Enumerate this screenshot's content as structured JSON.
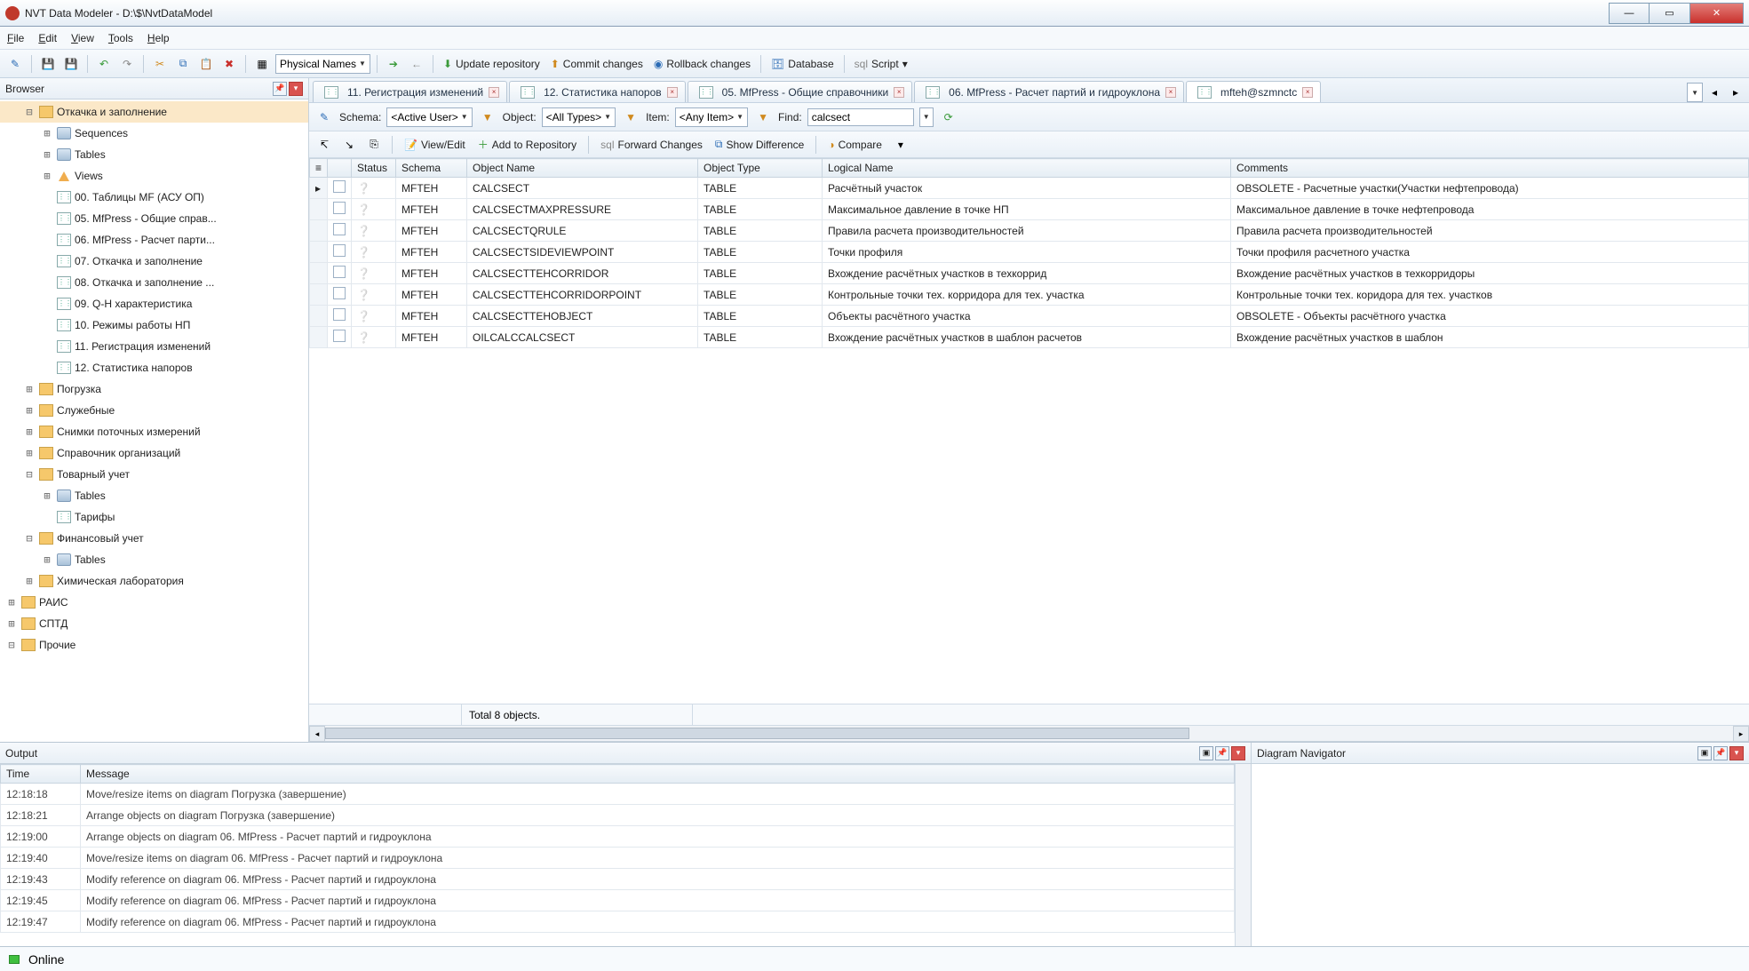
{
  "window": {
    "title": "NVT Data Modeler - D:\\$\\NvtDataModel"
  },
  "menu": {
    "file": "File",
    "edit": "Edit",
    "view": "View",
    "tools": "Tools",
    "help": "Help"
  },
  "toolbar": {
    "combo_mode": "Physical Names",
    "update": "Update repository",
    "commit": "Commit changes",
    "rollback": "Rollback changes",
    "database": "Database",
    "script": "Script"
  },
  "browser": {
    "title": "Browser",
    "nodes": [
      {
        "ind": 1,
        "exp": "⊟",
        "icon": "folder-open",
        "label": "Откачка и заполнение",
        "sel": true
      },
      {
        "ind": 2,
        "exp": "⊞",
        "icon": "cyl",
        "label": "Sequences"
      },
      {
        "ind": 2,
        "exp": "⊞",
        "icon": "cyl",
        "label": "Tables"
      },
      {
        "ind": 2,
        "exp": "⊞",
        "icon": "warn",
        "label": "Views"
      },
      {
        "ind": 2,
        "exp": "",
        "icon": "diag",
        "label": "00. Таблицы MF (АСУ ОП)"
      },
      {
        "ind": 2,
        "exp": "",
        "icon": "diag",
        "label": "05. MfPress - Общие справ..."
      },
      {
        "ind": 2,
        "exp": "",
        "icon": "diag",
        "label": "06. MfPress - Расчет парти..."
      },
      {
        "ind": 2,
        "exp": "",
        "icon": "diag",
        "label": "07. Откачка и заполнение"
      },
      {
        "ind": 2,
        "exp": "",
        "icon": "diag",
        "label": "08. Откачка и заполнение ..."
      },
      {
        "ind": 2,
        "exp": "",
        "icon": "diag",
        "label": "09. Q-H характеристика"
      },
      {
        "ind": 2,
        "exp": "",
        "icon": "diag",
        "label": "10. Режимы работы НП"
      },
      {
        "ind": 2,
        "exp": "",
        "icon": "diag",
        "label": "11. Регистрация изменений"
      },
      {
        "ind": 2,
        "exp": "",
        "icon": "diag",
        "label": "12. Статистика напоров"
      },
      {
        "ind": 1,
        "exp": "⊞",
        "icon": "folder",
        "label": "Погрузка"
      },
      {
        "ind": 1,
        "exp": "⊞",
        "icon": "folder",
        "label": "Служебные"
      },
      {
        "ind": 1,
        "exp": "⊞",
        "icon": "folder",
        "label": "Снимки поточных измерений"
      },
      {
        "ind": 1,
        "exp": "⊞",
        "icon": "folder",
        "label": "Справочник организаций"
      },
      {
        "ind": 1,
        "exp": "⊟",
        "icon": "folder-open",
        "label": "Товарный учет"
      },
      {
        "ind": 2,
        "exp": "⊞",
        "icon": "cyl",
        "label": "Tables"
      },
      {
        "ind": 2,
        "exp": "",
        "icon": "diag",
        "label": "Тарифы"
      },
      {
        "ind": 1,
        "exp": "⊟",
        "icon": "folder-open",
        "label": "Финансовый учет"
      },
      {
        "ind": 2,
        "exp": "⊞",
        "icon": "cyl",
        "label": "Tables"
      },
      {
        "ind": 1,
        "exp": "⊞",
        "icon": "folder",
        "label": "Химическая лаборатория"
      },
      {
        "ind": 0,
        "exp": "⊞",
        "icon": "folder",
        "label": "РАИС"
      },
      {
        "ind": 0,
        "exp": "⊞",
        "icon": "folder",
        "label": "СПТД"
      },
      {
        "ind": 0,
        "exp": "⊟",
        "icon": "folder",
        "label": "Прочие"
      }
    ]
  },
  "tabs": [
    {
      "label": "11. Регистрация изменений"
    },
    {
      "label": "12. Статистика напоров"
    },
    {
      "label": "05. MfPress - Общие справочники"
    },
    {
      "label": "06. MfPress - Расчет партий и гидроуклона"
    },
    {
      "label": "mfteh@szmnctc",
      "active": true
    }
  ],
  "filter": {
    "schema_lbl": "Schema:",
    "schema_val": "<Active User>",
    "object_lbl": "Object:",
    "object_val": "<All Types>",
    "item_lbl": "Item:",
    "item_val": "<Any Item>",
    "find_lbl": "Find:",
    "find_val": "calcsect"
  },
  "actions": {
    "viewedit": "View/Edit",
    "addrepo": "Add to Repository",
    "forward": "Forward Changes",
    "diff": "Show Difference",
    "compare": "Compare"
  },
  "grid": {
    "cols": {
      "status": "Status",
      "schema": "Schema",
      "objname": "Object Name",
      "objtype": "Object Type",
      "logname": "Logical Name",
      "comments": "Comments"
    },
    "rows": [
      {
        "schema": "MFTEH",
        "name_hl": "CALCSECT",
        "name_rest": "",
        "type": "TABLE",
        "log": "Расчётный участок",
        "com": "OBSOLETE - Расчетные участки(Участки нефтепровода)"
      },
      {
        "schema": "MFTEH",
        "name_hl": "CALCSECT",
        "name_rest": "MAXPRESSURE",
        "type": "TABLE",
        "log": "Максимальное давление в точке НП",
        "com": "Максимальное давление в точке нефтепровода"
      },
      {
        "schema": "MFTEH",
        "name_hl": "CALCSECT",
        "name_rest": "QRULE",
        "type": "TABLE",
        "log": "Правила расчета производительностей",
        "com": "Правила расчета производительностей"
      },
      {
        "schema": "MFTEH",
        "name_hl": "CALCSECT",
        "name_rest": "SIDEVIEWPOINT",
        "type": "TABLE",
        "log": "Точки профиля",
        "com": "Точки профиля расчетного участка"
      },
      {
        "schema": "MFTEH",
        "name_hl": "CALCSECT",
        "name_rest": "TEHCORRIDOR",
        "type": "TABLE",
        "log": "Вхождение расчётных участков в техкоррид",
        "com": "Вхождение расчётных участков в техкорридоры"
      },
      {
        "schema": "MFTEH",
        "name_hl": "CALCSECT",
        "name_rest": "TEHCORRIDORPOINT",
        "type": "TABLE",
        "log": "Контрольные точки тех. корридора для тех. участка",
        "com": "Контрольные точки тех. коридора для тех. участков"
      },
      {
        "schema": "MFTEH",
        "name_hl": "CALCSECT",
        "name_rest": "TEHOBJECT",
        "type": "TABLE",
        "log": "Объекты расчётного участка",
        "com": "OBSOLETE - Объекты расчётного участка"
      },
      {
        "schema": "MFTEH",
        "name_pre": "OILCALC",
        "name_hl": "CALCSECT",
        "name_rest": "",
        "type": "TABLE",
        "log": "Вхождение расчётных участков в шаблон расчетов",
        "com": "Вхождение расчётных участков в шаблон"
      }
    ],
    "footer": "Total 8 objects."
  },
  "output": {
    "title": "Output",
    "cols": {
      "time": "Time",
      "msg": "Message"
    },
    "rows": [
      {
        "t": "12:18:18",
        "m": "Move/resize items on diagram Погрузка (завершение)"
      },
      {
        "t": "12:18:21",
        "m": "Arrange objects on diagram Погрузка (завершение)"
      },
      {
        "t": "12:19:00",
        "m": "Arrange objects on diagram 06. MfPress - Расчет партий и гидроуклона"
      },
      {
        "t": "12:19:40",
        "m": "Move/resize items on diagram 06. MfPress - Расчет партий и гидроуклона"
      },
      {
        "t": "12:19:43",
        "m": "Modify reference on diagram 06. MfPress - Расчет партий и гидроуклона"
      },
      {
        "t": "12:19:45",
        "m": "Modify reference on diagram 06. MfPress - Расчет партий и гидроуклона"
      },
      {
        "t": "12:19:47",
        "m": "Modify reference on diagram 06. MfPress - Расчет партий и гидроуклона"
      }
    ]
  },
  "navigator": {
    "title": "Diagram Navigator"
  },
  "status": {
    "online": "Online"
  }
}
